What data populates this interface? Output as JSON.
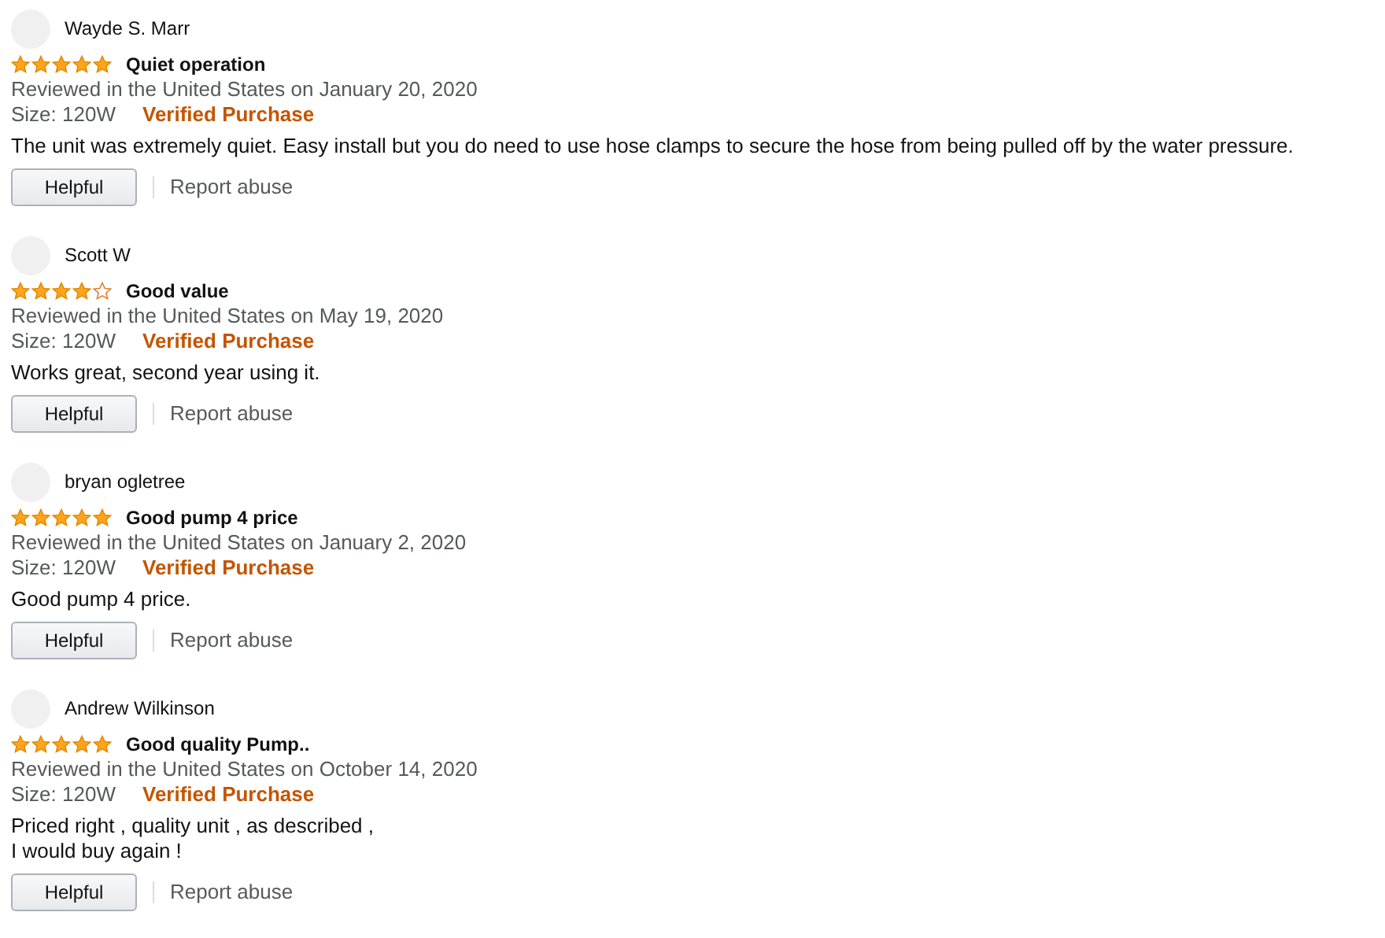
{
  "reviews": [
    {
      "name": "Wayde S. Marr",
      "stars": 5,
      "title": "Quiet operation",
      "date": "Reviewed in the United States on January 20, 2020",
      "size": "Size: 120W",
      "verified": "Verified Purchase",
      "body": [
        "The unit was extremely quiet. Easy install but you do need to use hose clamps to secure the hose from being pulled off by the water pressure."
      ],
      "helpful": "Helpful",
      "report": "Report abuse"
    },
    {
      "name": "Scott W",
      "stars": 4,
      "title": "Good value",
      "date": "Reviewed in the United States on May 19, 2020",
      "size": "Size: 120W",
      "verified": "Verified Purchase",
      "body": [
        "Works great, second year using it."
      ],
      "helpful": "Helpful",
      "report": "Report abuse"
    },
    {
      "name": "bryan ogletree",
      "stars": 5,
      "title": "Good pump 4 price",
      "date": "Reviewed in the United States on January 2, 2020",
      "size": "Size: 120W",
      "verified": "Verified Purchase",
      "body": [
        "Good pump 4 price."
      ],
      "helpful": "Helpful",
      "report": "Report abuse"
    },
    {
      "name": "Andrew Wilkinson",
      "stars": 5,
      "title": "Good quality Pump..",
      "date": "Reviewed in the United States on October 14, 2020",
      "size": "Size: 120W",
      "verified": "Verified Purchase",
      "body": [
        "Priced right , quality unit , as described ,",
        "I would buy again !"
      ],
      "helpful": "Helpful",
      "report": "Report abuse"
    }
  ]
}
